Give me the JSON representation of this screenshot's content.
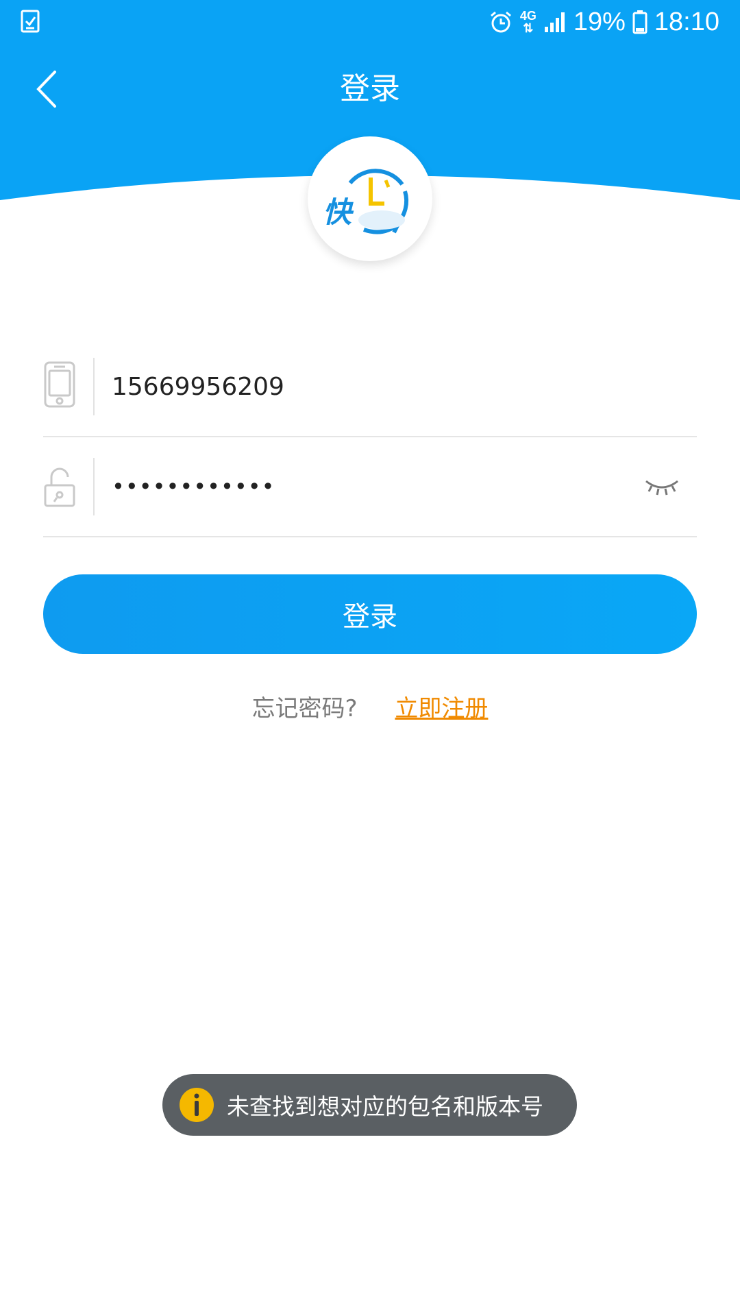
{
  "status_bar": {
    "battery": "19%",
    "time": "18:10",
    "network": "4G",
    "icons": [
      "task-check-icon",
      "alarm-icon",
      "signal-icon",
      "battery-icon"
    ]
  },
  "header": {
    "title": "登录",
    "back_icon": "chevron-left-icon"
  },
  "logo": {
    "text": "快",
    "icon": "clock-logo-icon"
  },
  "form": {
    "phone": {
      "icon": "phone-icon",
      "value": "15669956209"
    },
    "password": {
      "icon": "lock-icon",
      "value": "••••••••••••",
      "toggle_icon": "eye-closed-icon"
    }
  },
  "login_button": {
    "label": "登录"
  },
  "links": {
    "forgot": "忘记密码?",
    "register": "立即注册"
  },
  "toast": {
    "icon": "info-icon",
    "message": "未查找到想对应的包名和版本号"
  },
  "colors": {
    "primary": "#0aa3f5",
    "register_link": "#f08a00",
    "toast_bg": "#5a5f63",
    "toast_icon": "#f5b800"
  }
}
